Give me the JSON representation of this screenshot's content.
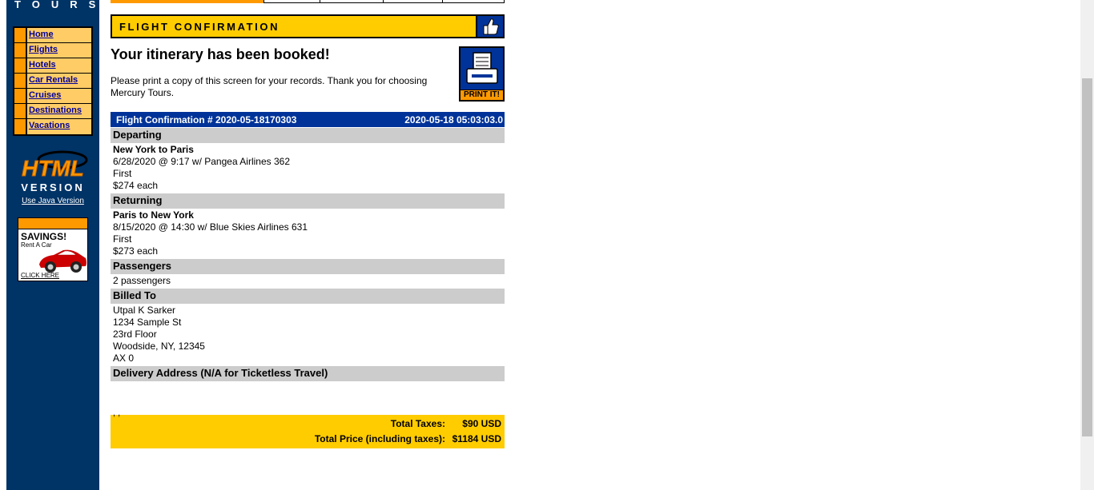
{
  "brand": {
    "logo_text": "TOURS"
  },
  "nav": {
    "items": [
      {
        "label": "Home"
      },
      {
        "label": "Flights"
      },
      {
        "label": "Hotels"
      },
      {
        "label": "Car Rentals"
      },
      {
        "label": "Cruises"
      },
      {
        "label": "Destinations"
      },
      {
        "label": "Vacations"
      }
    ]
  },
  "html_version": {
    "line1": "HTML",
    "line2": "VERSION"
  },
  "java_link": "Use Java Version",
  "ad": {
    "title": "SAVINGS!",
    "subtitle": "Rent A Car",
    "cta": "CLICK HERE"
  },
  "header": {
    "title": "FLIGHT CONFIRMATION"
  },
  "itinerary": {
    "title": "Your itinerary has been booked!",
    "intro": "Please print a copy of this screen for your records. Thank you for choosing Mercury Tours.",
    "print_label": "PRINT IT!"
  },
  "confirmation": {
    "number_label": "Flight Confirmation # 2020-05-18170303",
    "timestamp": "2020-05-18 05:03:03.0",
    "departing": {
      "heading": "Departing",
      "route": "New York to Paris",
      "flight": "6/28/2020 @ 9:17 w/ Pangea Airlines 362",
      "class": "First",
      "price": "$274 each"
    },
    "returning": {
      "heading": "Returning",
      "route": "Paris to New York",
      "flight": "8/15/2020 @ 14:30 w/ Blue Skies Airlines 631",
      "class": "First",
      "price": "$273 each"
    },
    "passengers": {
      "heading": "Passengers",
      "value": "2 passengers"
    },
    "billed_to": {
      "heading": "Billed To",
      "name": "Utpal K Sarker",
      "street": "1234 Sample St",
      "unit": "23rd Floor",
      "city": "Woodside, NY, 12345",
      "card": "AX 0"
    },
    "delivery": {
      "heading": "Delivery Address (N/A for Ticketless Travel)",
      "value": ", ,"
    },
    "totals": {
      "taxes_label": "Total Taxes:",
      "taxes_value": "$90 USD",
      "price_label": "Total Price (including taxes):",
      "price_value": "$1184 USD"
    }
  },
  "colors": {
    "navy": "#003366",
    "blue": "#003399",
    "yellow": "#ffcc00",
    "orange": "#ff9900",
    "light_orange": "#ffcc66",
    "gray": "#cccccc"
  }
}
